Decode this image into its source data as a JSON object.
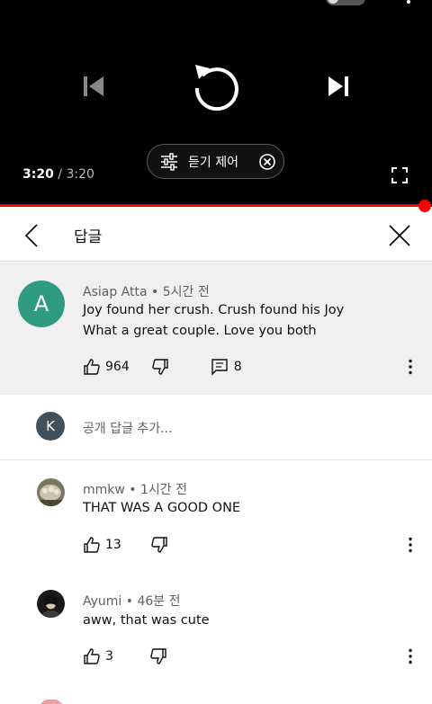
{
  "player": {
    "current_time": "3:20",
    "separator": " / ",
    "total_time": "3:20",
    "listen_control_label": "듣기 제어",
    "progress_fraction": 1.0
  },
  "header": {
    "title": "답글"
  },
  "main_comment": {
    "avatar_letter": "A",
    "avatar_color": "#2e9a7f",
    "author": "Asiap Atta",
    "time": "5시간 전",
    "lines": [
      "Joy found her crush. Crush found his Joy",
      "What a great couple. Love you both"
    ],
    "likes": "964",
    "replies": "8"
  },
  "add_reply": {
    "avatar_letter": "K",
    "placeholder": "공개 답글 추가..."
  },
  "replies": [
    {
      "author": "mmkw",
      "time": "1시간 전",
      "text": "THAT WAS A GOOD ONE",
      "likes": "13"
    },
    {
      "author": "Ayumi",
      "time": "46분 전",
      "text": "aww, that was cute",
      "likes": "3"
    }
  ],
  "dot": "•"
}
